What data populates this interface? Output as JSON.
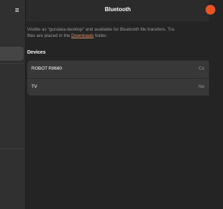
{
  "window": {
    "title": "Bluetooth"
  },
  "description": {
    "line1": "Visible as “gundala-desktop” and available for Bluetooth file transfers. Tra",
    "line2_prefix": "files are placed in the ",
    "link": "Downloads",
    "line2_suffix": " folder."
  },
  "devices": {
    "title": "Devices",
    "items": [
      {
        "name": "ROBOT R8680",
        "status": "Co"
      },
      {
        "name": "TV",
        "status": "No"
      }
    ]
  },
  "colors": {
    "accent": "#e95420",
    "link": "#e0956b",
    "background": "#242424",
    "sidebar": "#303030",
    "row": "#383838"
  }
}
